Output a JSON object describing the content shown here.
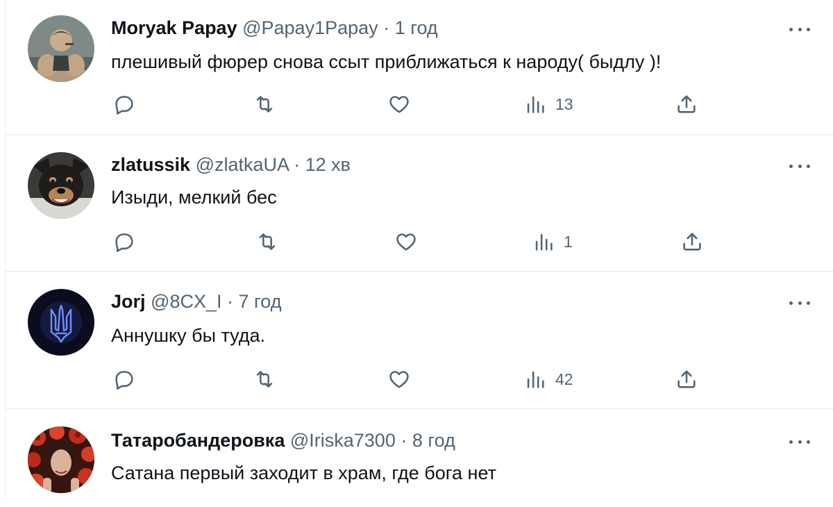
{
  "colors": {
    "text": "#0f1419",
    "secondary": "#536471",
    "border": "#eff3f4"
  },
  "more_label": "More",
  "tweets": [
    {
      "name": "Moryak Papay",
      "handle": "@Papay1Papay",
      "separator": "·",
      "time": "1 год",
      "text": "плешивый фюрер снова ссыт приближаться к народу( быдлу )!",
      "views": "13",
      "avatar": "muscular-cartoon-sailor"
    },
    {
      "name": "zlatussik",
      "handle": "@zlatkaUA",
      "separator": "·",
      "time": "12 хв",
      "text": "Изыди, мелкий бес",
      "views": "1",
      "avatar": "barking-dog"
    },
    {
      "name": "Jorj",
      "handle": "@8CX_I",
      "separator": "·",
      "time": "7 год",
      "text": "Аннушку бы туда.",
      "views": "42",
      "avatar": "ukrainian-trident-emblem"
    },
    {
      "name": "Татаробандеровка",
      "handle": "@Iriska7300",
      "separator": "·",
      "time": "8 год",
      "text": "Сатана первый заходит в храм, где бога нет",
      "views": "",
      "avatar": "woman-with-red-flowers"
    }
  ]
}
